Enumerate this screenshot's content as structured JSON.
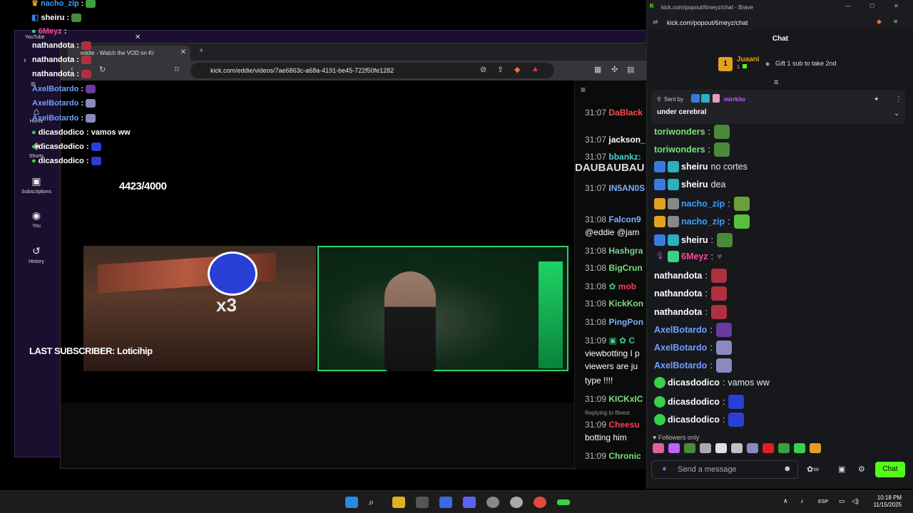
{
  "youtube": {
    "tab_label": "YouTube",
    "rail": [
      {
        "label": "Home",
        "icon": "home-icon"
      },
      {
        "label": "Shorts",
        "icon": "shorts-icon"
      },
      {
        "label": "Subscriptions",
        "icon": "subscriptions-icon"
      },
      {
        "label": "You",
        "icon": "you-icon"
      },
      {
        "label": "History",
        "icon": "history-icon"
      }
    ]
  },
  "browser": {
    "tab_title": "eddie - Watch the VOD on Ki",
    "url": "kick.com/eddie/videos/7ae6863c-a68a-4191-be45-722f50fe1282"
  },
  "stream": {
    "goal": "4423/4000",
    "multiplier": "x3",
    "last_subscriber": "LAST SUBSCRIBER: Loticihip"
  },
  "overlay_chat": [
    {
      "name": "nacho_zip",
      "text": ":",
      "color": "#3aa0ff"
    },
    {
      "name": "sheiru",
      "text": ":",
      "color": "#ffffff"
    },
    {
      "name": "6Meyz",
      "text": ":",
      "color": "#ff4a9a"
    },
    {
      "name": "nathandota",
      "text": ":",
      "color": "#ffffff"
    },
    {
      "name": "nathandota",
      "text": ":",
      "color": "#ffffff"
    },
    {
      "name": "nathandota",
      "text": ":",
      "color": "#ffffff"
    },
    {
      "name": "AxelBotardo",
      "text": ":",
      "color": "#6fa0ff"
    },
    {
      "name": "AxelBotardo",
      "text": ":",
      "color": "#6fa0ff"
    },
    {
      "name": "AxelBotardo",
      "text": ":",
      "color": "#6fa0ff"
    },
    {
      "name": "dicasdodico",
      "text": ": vamos ww",
      "color": "#ffffff"
    },
    {
      "name": "dicasdodico",
      "text": ":",
      "color": "#ffffff"
    },
    {
      "name": "dicasdodico",
      "text": ":",
      "color": "#ffffff"
    }
  ],
  "vod_chat": [
    {
      "time": "31:07",
      "name": "DaBlack",
      "color": "#ff4a4a"
    },
    {
      "time": "31:07",
      "name": "jackson_",
      "color": "#ffffff"
    },
    {
      "time": "31:07",
      "name": "bbankz:",
      "color": "#4ad0d0"
    },
    {
      "time": "",
      "name": "DAUBAUBAU",
      "color": "#dddddd"
    },
    {
      "time": "31:07",
      "name": "IN5AN0S",
      "color": "#7ab0ff"
    },
    {
      "time": "31:08",
      "name": "Falcon9",
      "color": "#7ab0ff"
    },
    {
      "time": "",
      "name": "@eddie @jam",
      "color": "#ffffff"
    },
    {
      "time": "31:08",
      "name": "Hashgra",
      "color": "#7ad0a0"
    },
    {
      "time": "31:08",
      "name": "BigCrun",
      "color": "#7ae07a"
    },
    {
      "time": "31:08",
      "name": "mob",
      "color": "#ff3a5a"
    },
    {
      "time": "31:08",
      "name": "KickKon",
      "color": "#7ae07a"
    },
    {
      "time": "31:08",
      "name": "PingPon",
      "color": "#7ab0ff"
    },
    {
      "time": "31:09",
      "name": "C",
      "color": "#3ad08a"
    },
    {
      "time": "",
      "name": "viewbotting I p",
      "color": "#ffffff"
    },
    {
      "time": "",
      "name": "viewers are ju",
      "color": "#ffffff"
    },
    {
      "time": "",
      "name": "type !!!!",
      "color": "#ffffff"
    },
    {
      "time": "31:09",
      "name": "KICKxIC",
      "color": "#7ae07a"
    },
    {
      "time": "",
      "name": "Replying to filvest",
      "color": "#999999"
    },
    {
      "time": "31:09",
      "name": "Cheesu",
      "color": "#ff3a5a"
    },
    {
      "time": "",
      "name": "botting him",
      "color": "#ffffff"
    },
    {
      "time": "31:09",
      "name": "Chronic",
      "color": "#7ae07a"
    }
  ],
  "popout": {
    "window_title": "kick.com/popout/6meyz/chat - Brave",
    "url": "kick.com/popout/6meyz/chat",
    "header": "Chat",
    "top_gifter": {
      "rank": "1",
      "name": "Juaani",
      "count": "1",
      "cta": "Gift 1 sub to take 2nd"
    },
    "pinned": {
      "sent_by_label": "Sent by",
      "sender": "mirrkito",
      "text": "under cerebral"
    },
    "messages": [
      {
        "name": "toriwonders",
        "text": "",
        "color": "#7ae07a",
        "badges": []
      },
      {
        "name": "toriwonders",
        "text": "",
        "color": "#7ae07a",
        "badges": []
      },
      {
        "name": "sheiru",
        "text": "no cortes",
        "color": "#ffffff",
        "badges": [
          "#3a7ae0",
          "#2ab0c0"
        ]
      },
      {
        "name": "sheiru",
        "text": "dea",
        "color": "#ffffff",
        "badges": [
          "#3a7ae0",
          "#2ab0c0"
        ]
      },
      {
        "name": "nacho_zip",
        "text": "",
        "color": "#3aa0ff",
        "badges": [
          "#e0a020",
          "#888888"
        ]
      },
      {
        "name": "nacho_zip",
        "text": "",
        "color": "#3aa0ff",
        "badges": [
          "#e0a020",
          "#888888"
        ]
      },
      {
        "name": "sheiru",
        "text": "",
        "color": "#ffffff",
        "badges": [
          "#3a7ae0",
          "#2ab0c0"
        ]
      },
      {
        "name": "6Meyz",
        "text": "",
        "color": "#ff4a9a",
        "badges": [
          "#b04ae0",
          "#3ad08a"
        ]
      },
      {
        "name": "nathandota",
        "text": "",
        "color": "#ffffff",
        "badges": []
      },
      {
        "name": "nathandota",
        "text": "",
        "color": "#ffffff",
        "badges": []
      },
      {
        "name": "nathandota",
        "text": "",
        "color": "#ffffff",
        "badges": []
      },
      {
        "name": "AxelBotardo",
        "text": "",
        "color": "#6fa0ff",
        "badges": []
      },
      {
        "name": "AxelBotardo",
        "text": "",
        "color": "#6fa0ff",
        "badges": []
      },
      {
        "name": "AxelBotardo",
        "text": "",
        "color": "#6fa0ff",
        "badges": []
      },
      {
        "name": "dicasdodico",
        "text": "vamos ww",
        "color": "#ffffff",
        "badges": [
          "#3ad04a"
        ]
      },
      {
        "name": "dicasdodico",
        "text": "",
        "color": "#ffffff",
        "badges": [
          "#3ad04a"
        ]
      },
      {
        "name": "dicasdodico",
        "text": "",
        "color": "#ffffff",
        "badges": [
          "#3ad04a"
        ]
      }
    ],
    "followers_only": "Followers only",
    "send_placeholder": "Send a message",
    "chat_button": "Chat"
  },
  "taskbar": {
    "language": "ESP",
    "time": "10:18 PM",
    "date": "11/15/2025"
  },
  "colors": {
    "kick_green": "#53fc18",
    "cam_border": "#2cd46a"
  }
}
